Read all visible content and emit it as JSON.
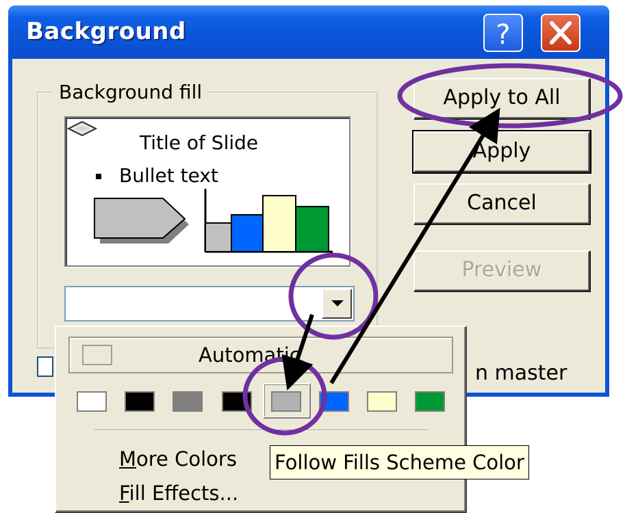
{
  "dialog": {
    "title": "Background",
    "help_button": "?",
    "close_button": "close",
    "group_label": "Background fill",
    "preview": {
      "slide_title": "Title of Slide",
      "bullet_text": "Bullet text",
      "chart_colors": [
        "#c0c0c0",
        "#0066ff",
        "#ffffcc",
        "#009933"
      ]
    },
    "buttons": {
      "apply_to_all": "Apply to All",
      "apply": "Apply",
      "cancel": "Cancel",
      "preview": "Preview"
    },
    "omit_graphics_label_visible": "n master"
  },
  "dropdown": {
    "automatic_label": "Automatic",
    "swatches": [
      {
        "name": "white",
        "color": "#ffffff"
      },
      {
        "name": "black",
        "color": "#000000"
      },
      {
        "name": "gray",
        "color": "#808080"
      },
      {
        "name": "black-2",
        "color": "#000000"
      },
      {
        "name": "silver",
        "color": "#b2b2b2",
        "selected": true
      },
      {
        "name": "blue",
        "color": "#0066ff"
      },
      {
        "name": "light-yellow",
        "color": "#ffffcc"
      },
      {
        "name": "green",
        "color": "#009933"
      }
    ],
    "more_colors": {
      "underline": "M",
      "rest": "ore Colors"
    },
    "fill_effects": {
      "underline": "F",
      "rest": "ill Effects..."
    }
  },
  "tooltip": "Follow Fills Scheme Color",
  "annotation_colors": {
    "circle": "#7030a0",
    "arrow": "#000000"
  }
}
